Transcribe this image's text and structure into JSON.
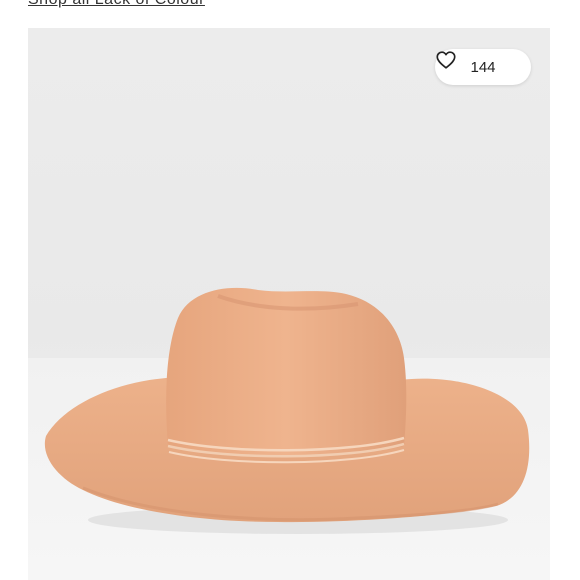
{
  "shop_link": {
    "label": "Shop all Lack of Colour"
  },
  "listing": {
    "like_count": "144"
  },
  "colors": {
    "hat": "#e8a982",
    "background": "#ececec",
    "pill": "#ffffff"
  }
}
